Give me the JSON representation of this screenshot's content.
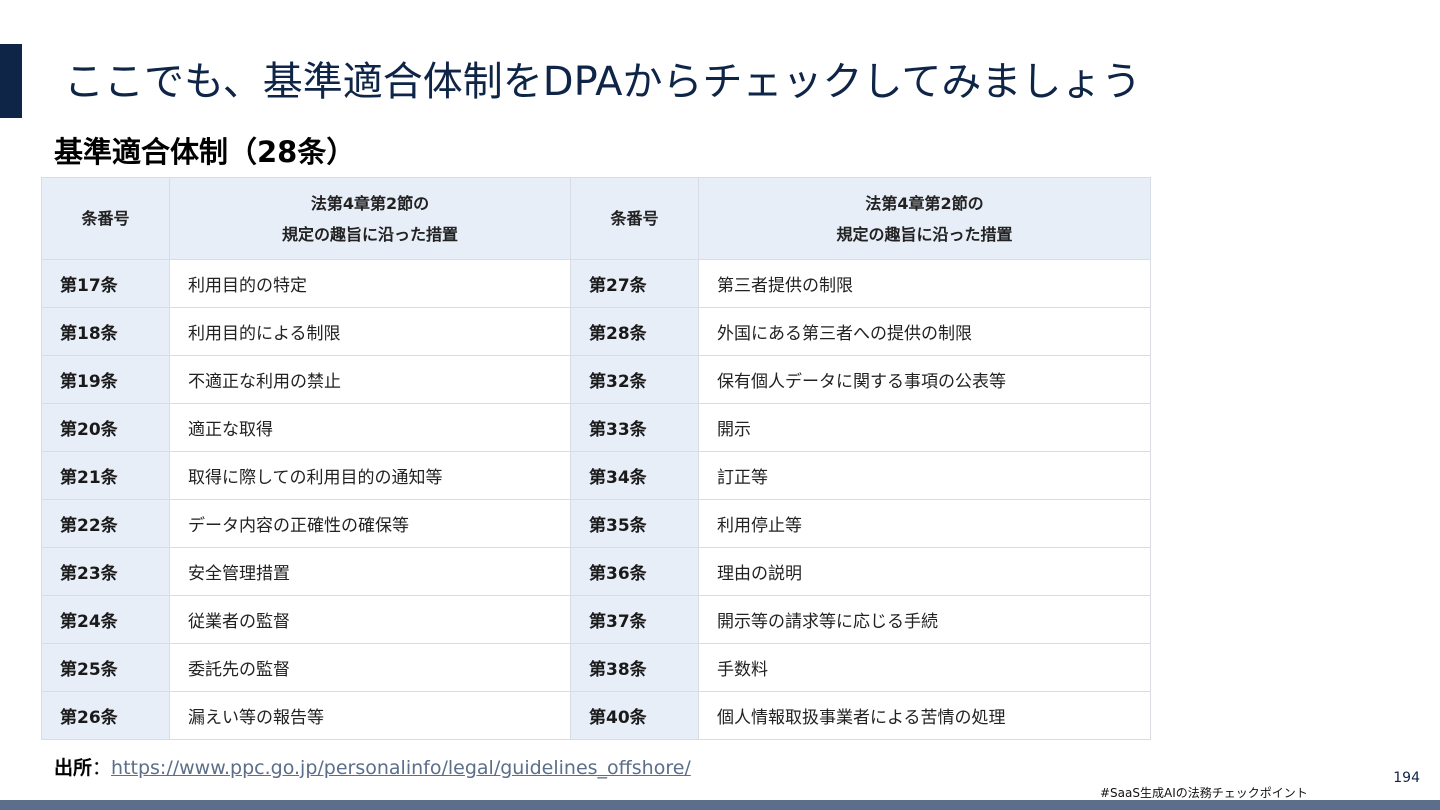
{
  "slide": {
    "title": "ここでも、基準適合体制をDPAからチェックしてみましょう",
    "section_heading": "基準適合体制（28条）",
    "page_number": "194",
    "footer_tag": "#SaaS生成AIの法務チェックポイント",
    "accent_color": "#0f2548"
  },
  "table": {
    "headers": {
      "number": "条番号",
      "desc_line1": "法第4章第2節の",
      "desc_line2": "規定の趣旨に沿った措置"
    },
    "rows": [
      {
        "left_num": "第17条",
        "left_desc": "利用目的の特定",
        "right_num": "第27条",
        "right_desc": "第三者提供の制限"
      },
      {
        "left_num": "第18条",
        "left_desc": "利用目的による制限",
        "right_num": "第28条",
        "right_desc": "外国にある第三者への提供の制限"
      },
      {
        "left_num": "第19条",
        "left_desc": "不適正な利用の禁止",
        "right_num": "第32条",
        "right_desc": "保有個人データに関する事項の公表等"
      },
      {
        "left_num": "第20条",
        "left_desc": "適正な取得",
        "right_num": "第33条",
        "right_desc": "開示"
      },
      {
        "left_num": "第21条",
        "left_desc": "取得に際しての利用目的の通知等",
        "right_num": "第34条",
        "right_desc": "訂正等"
      },
      {
        "left_num": "第22条",
        "left_desc": "データ内容の正確性の確保等",
        "right_num": "第35条",
        "right_desc": "利用停止等"
      },
      {
        "left_num": "第23条",
        "left_desc": "安全管理措置",
        "right_num": "第36条",
        "right_desc": "理由の説明"
      },
      {
        "left_num": "第24条",
        "left_desc": "従業者の監督",
        "right_num": "第37条",
        "right_desc": "開示等の請求等に応じる手続"
      },
      {
        "left_num": "第25条",
        "left_desc": "委託先の監督",
        "right_num": "第38条",
        "right_desc": "手数料"
      },
      {
        "left_num": "第26条",
        "left_desc": "漏えい等の報告等",
        "right_num": "第40条",
        "right_desc": "個人情報取扱事業者による苦情の処理"
      }
    ]
  },
  "source": {
    "label": "出所",
    "separator": "：",
    "url": "https://www.ppc.go.jp/personalinfo/legal/guidelines_offshore/"
  }
}
